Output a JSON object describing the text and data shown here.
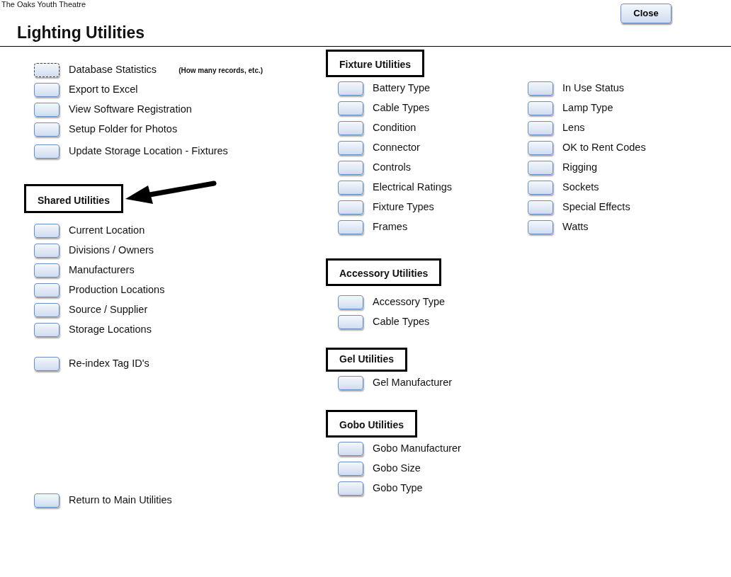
{
  "app_name": "The Oaks Youth Theatre",
  "title": "Lighting Utilities",
  "close_button": "Close",
  "general_items": [
    {
      "label": "Database Statistics",
      "note": "(How many records, etc.)",
      "focused": true
    },
    {
      "label": "Export to Excel",
      "focused": false
    },
    {
      "label": "View Software Registration",
      "focused": false
    },
    {
      "label": "Setup Folder for Photos",
      "focused": false
    },
    {
      "label": "Update Storage Location - Fixtures",
      "focused": false
    }
  ],
  "shared": {
    "title": "Shared Utilities",
    "pointed_at": true,
    "groups": [
      [
        "Current Location",
        "Divisions / Owners",
        "Manufacturers",
        "Production Locations",
        "Source / Supplier",
        "Storage Locations"
      ],
      [
        "Re-index Tag ID's"
      ],
      [
        "Return to Main Utilities"
      ]
    ]
  },
  "sections": [
    {
      "title": "Fixture Utilities",
      "columns": [
        [
          "Battery Type",
          "Cable Types",
          "Condition",
          "Connector",
          "Controls",
          "Electrical Ratings",
          "Fixture Types",
          "Frames"
        ],
        [
          "In Use Status",
          "Lamp Type",
          "Lens",
          "OK to Rent Codes",
          "Rigging",
          "Sockets",
          "Special Effects",
          "Watts"
        ]
      ]
    },
    {
      "title": "Accessory Utilities",
      "columns": [
        [
          "Accessory Type",
          "Cable Types"
        ]
      ]
    },
    {
      "title": "Gel Utilities",
      "columns": [
        [
          "Gel Manufacturer"
        ]
      ]
    },
    {
      "title": "Gobo Utilities",
      "columns": [
        [
          "Gobo Manufacturer",
          "Gobo Size",
          "Gobo Type"
        ]
      ]
    }
  ]
}
